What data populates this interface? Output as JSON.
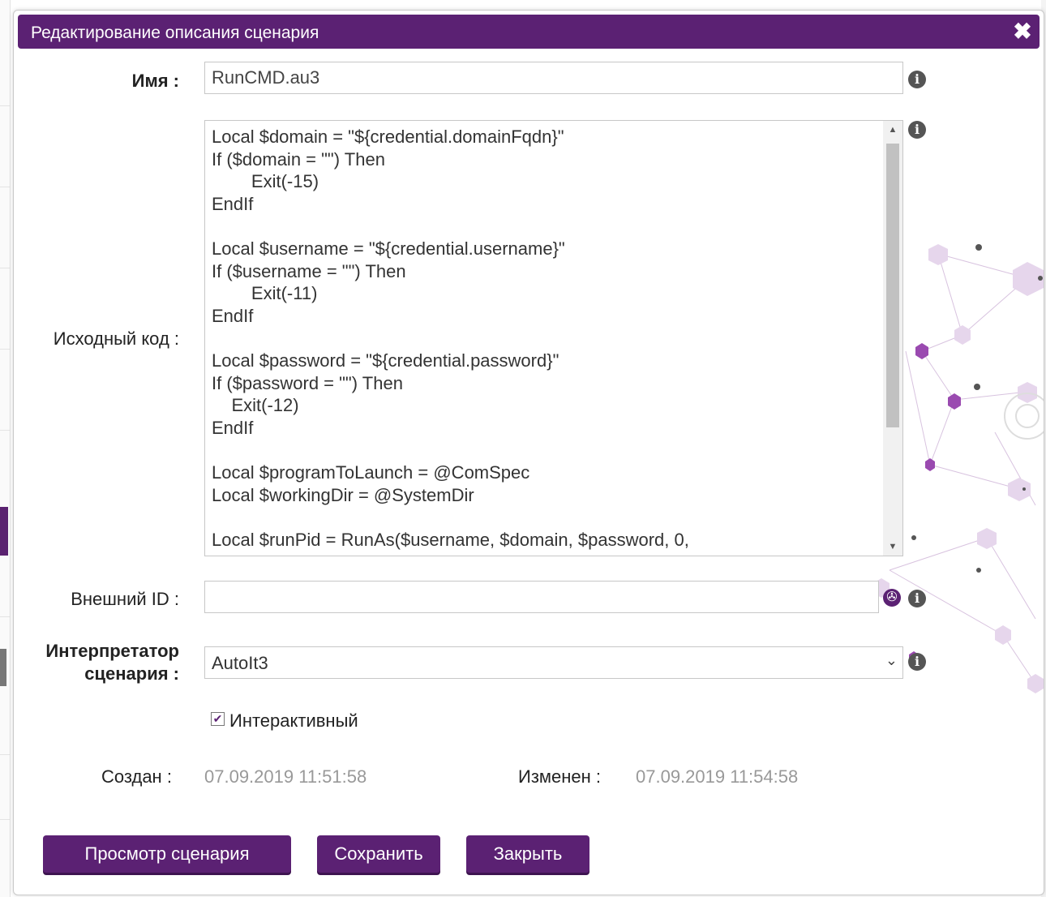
{
  "dialog": {
    "title": "Редактирование описания сценария"
  },
  "form": {
    "name_label": "Имя :",
    "name_value": "RunCMD.au3",
    "source_label": "Исходный код :",
    "source_lines": [
      "Local $domain = \"${credential.domainFqdn}\"",
      "If ($domain = \"\") Then",
      "        Exit(-15)",
      "EndIf",
      "",
      "Local $username = \"${credential.username}\"",
      "If ($username = \"\") Then",
      "        Exit(-11)",
      "EndIf",
      "",
      "Local $password = \"${credential.password}\"",
      "If ($password = \"\") Then",
      "    Exit(-12)",
      "EndIf",
      "",
      "Local $programToLaunch = @ComSpec",
      "Local $workingDir = @SystemDir",
      "",
      "Local $runPid = RunAs($username, $domain, $password, 0,"
    ],
    "external_id_label": "Внешний ID :",
    "external_id_value": "",
    "interpreter_label_line1": "Интерпретатор",
    "interpreter_label_line2": "сценария :",
    "interpreter_value": "AutoIt3",
    "interactive_label": "Интерактивный",
    "interactive_checked": true,
    "created_label": "Создан :",
    "created_value": "07.09.2019 11:51:58",
    "modified_label": "Изменен :",
    "modified_value": "07.09.2019 11:54:58"
  },
  "buttons": {
    "preview": "Просмотр сценария",
    "save": "Сохранить",
    "close": "Закрыть"
  },
  "icons": {
    "info": "info-icon",
    "close": "close-icon",
    "globe": "globe-icon"
  },
  "colors": {
    "accent": "#5b2173"
  }
}
